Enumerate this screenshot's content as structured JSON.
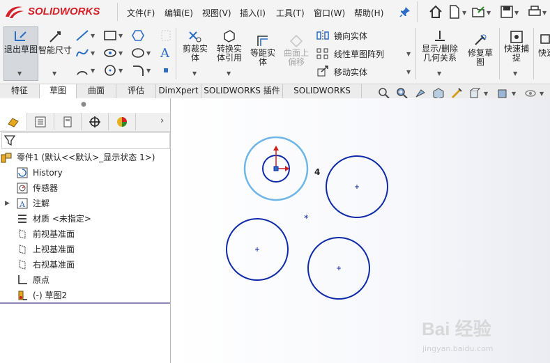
{
  "app": {
    "brand": "SOLIDWORKS",
    "brand_color": "#d42027"
  },
  "menu": [
    "文件(F)",
    "编辑(E)",
    "视图(V)",
    "插入(I)",
    "工具(T)",
    "窗口(W)",
    "帮助(H)"
  ],
  "ribbon": {
    "exit_sketch": "退出草图",
    "smart_dim": "智能尺寸",
    "trim": "剪裁实体",
    "convert": "转换实体引用",
    "offset": "等距实体",
    "surface_offset": "曲面上偏移",
    "mirror": "镜向实体",
    "linear_pattern": "线性草图阵列",
    "move": "移动实体",
    "relations": "显示/删除几何关系",
    "repair": "修复草图",
    "quick_snap": "快速捕捉",
    "quick_more": "快速"
  },
  "tabs": [
    "特征",
    "草图",
    "曲面",
    "评估",
    "DimXpert",
    "SOLIDWORKS 插件",
    "SOLIDWORKS MBD"
  ],
  "active_tab": "草图",
  "tree": {
    "root": "零件1  (默认<<默认>_显示状态 1>)",
    "items": [
      "History",
      "传感器",
      "注解",
      "材质 <未指定>",
      "前视基准面",
      "上视基准面",
      "右视基准面",
      "原点",
      "(-) 草图2"
    ]
  },
  "canvas": {
    "relation_marker": "4"
  },
  "watermark": {
    "text": "Bai 经验",
    "url": "jingyan.baidu.com"
  },
  "colors": {
    "sketch_blue": "#0f2aa8",
    "selected_blue": "#6fb6e6",
    "origin_red": "#d01f1f"
  }
}
